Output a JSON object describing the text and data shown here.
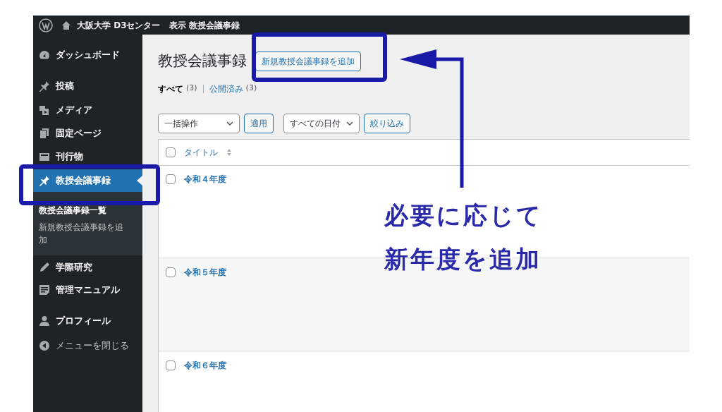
{
  "admin_bar": {
    "site": "大阪大学 D3センター",
    "view": "表示 教授会議事録"
  },
  "sidebar": {
    "items": [
      {
        "label": "ダッシュボード",
        "selected": false
      },
      {
        "label": "投稿",
        "selected": false
      },
      {
        "label": "メディア",
        "selected": false
      },
      {
        "label": "固定ページ",
        "selected": false
      },
      {
        "label": "刊行物",
        "selected": false
      },
      {
        "label": "教授会議事録",
        "selected": true,
        "children": [
          {
            "label": "教授会議事録一覧",
            "selected": true
          },
          {
            "label": "新規教授会議事録を追加",
            "selected": false
          }
        ]
      },
      {
        "label": "学際研究",
        "selected": false
      },
      {
        "label": "管理マニュアル",
        "selected": false
      },
      {
        "label": "プロフィール",
        "selected": false
      },
      {
        "label": "メニューを閉じる",
        "selected": false,
        "kind": "collapse"
      }
    ]
  },
  "page": {
    "title": "教授会議事録",
    "add_button": "新規教授会議事録を追加",
    "views": [
      {
        "label": "すべて",
        "count": "(3)",
        "selected": true
      },
      {
        "label": "公開済み",
        "count": "(3)",
        "selected": false
      }
    ],
    "bulk_action": "一括操作",
    "apply": "適用",
    "date_filter": "すべての日付",
    "filter": "絞り込み"
  },
  "table": {
    "select_all_checked": false,
    "columns": [
      "タイトル"
    ],
    "rows": [
      {
        "title": "令和４年度",
        "checked": false
      },
      {
        "title": "令和５年度",
        "checked": false
      },
      {
        "title": "令和６年度",
        "checked": false
      }
    ]
  },
  "annotation": {
    "lines": [
      "必要に応じて",
      "新年度を追加"
    ]
  }
}
